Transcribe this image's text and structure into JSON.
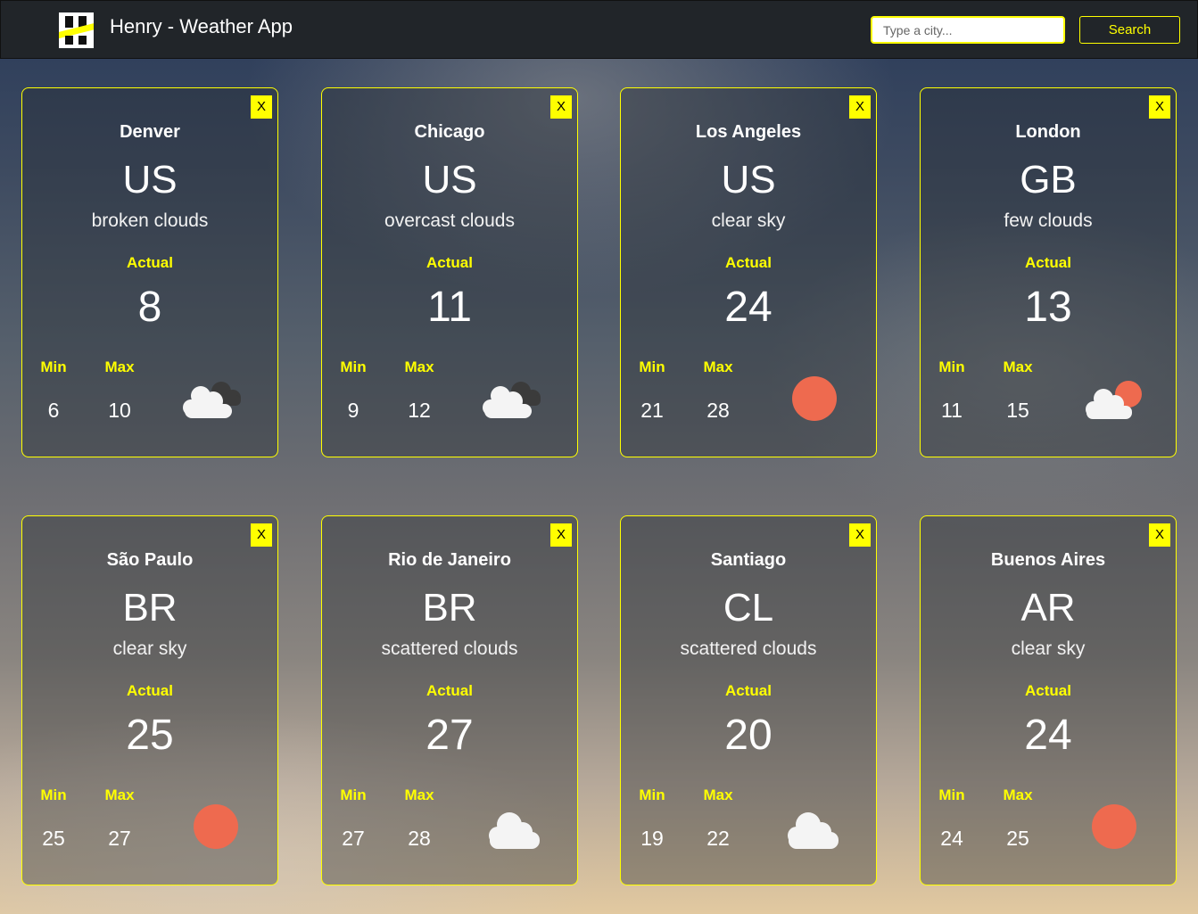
{
  "header": {
    "title": "Henry - Weather App",
    "search_placeholder": "Type a city...",
    "search_label": "Search"
  },
  "colors": {
    "accent": "#ffff00",
    "header_bg": "#212529",
    "sun": "#ee6a4f",
    "cloud": "#f4f4f4"
  },
  "labels": {
    "close": "X",
    "actual": "Actual",
    "min": "Min",
    "max": "Max"
  },
  "cards": [
    {
      "city": "Denver",
      "country": "US",
      "description": "broken clouds",
      "actual": "8",
      "min": "6",
      "max": "10",
      "icon": "broken-clouds-icon"
    },
    {
      "city": "Chicago",
      "country": "US",
      "description": "overcast clouds",
      "actual": "11",
      "min": "9",
      "max": "12",
      "icon": "overcast-clouds-icon"
    },
    {
      "city": "Los Angeles",
      "country": "US",
      "description": "clear sky",
      "actual": "24",
      "min": "21",
      "max": "28",
      "icon": "clear-sky-icon"
    },
    {
      "city": "London",
      "country": "GB",
      "description": "few clouds",
      "actual": "13",
      "min": "11",
      "max": "15",
      "icon": "few-clouds-icon"
    },
    {
      "city": "São Paulo",
      "country": "BR",
      "description": "clear sky",
      "actual": "25",
      "min": "25",
      "max": "27",
      "icon": "clear-sky-icon"
    },
    {
      "city": "Rio de Janeiro",
      "country": "BR",
      "description": "scattered clouds",
      "actual": "27",
      "min": "27",
      "max": "28",
      "icon": "scattered-clouds-icon"
    },
    {
      "city": "Santiago",
      "country": "CL",
      "description": "scattered clouds",
      "actual": "20",
      "min": "19",
      "max": "22",
      "icon": "scattered-clouds-icon"
    },
    {
      "city": "Buenos Aires",
      "country": "AR",
      "description": "clear sky",
      "actual": "24",
      "min": "24",
      "max": "25",
      "icon": "clear-sky-icon"
    }
  ]
}
